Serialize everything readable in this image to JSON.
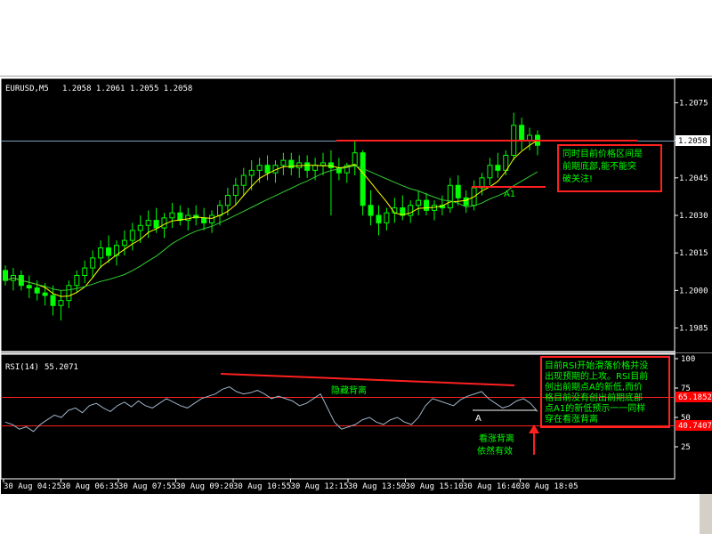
{
  "header": {
    "symbol": "EURUSD,M5",
    "ohlc": "1.2058 1.2061 1.2055 1.2058"
  },
  "rsi_header": {
    "label": "RSI(14)",
    "value": "55.2071"
  },
  "price_axis": {
    "ticks": [
      "1.2075",
      "1.2060",
      "1.2045",
      "1.2030",
      "1.2015",
      "1.2000",
      "1.1985"
    ],
    "tick_values": [
      1.2075,
      1.206,
      1.2045,
      1.203,
      1.2015,
      1.2,
      1.1985
    ],
    "current_price": "1.2058"
  },
  "rsi_axis": {
    "ticks": [
      "100",
      "75",
      "50",
      "25"
    ],
    "tick_values": [
      100,
      75,
      50,
      25
    ],
    "upper_level": "65.1852",
    "lower_level": "40.7407"
  },
  "time_axis": [
    "30 Aug 04:25",
    "30 Aug 06:35",
    "30 Aug 07:55",
    "30 Aug 09:20",
    "30 Aug 10:55",
    "30 Aug 12:15",
    "30 Aug 13:50",
    "30 Aug 15:10",
    "30 Aug 16:40",
    "30 Aug 18:05"
  ],
  "annotations": {
    "price_box": [
      "同时目前价格区间是",
      "前期底部,能不能突",
      "破关注!"
    ],
    "rsi_box": [
      "目前RSI开始滑落价格并没",
      "出现预期的上攻。RSI目前",
      "创出前期点A的新低,而价",
      "格目前没有创出前期底部",
      "点A1的新低预示一一同样",
      "穿在看涨背离"
    ],
    "hidden_divergence": "隐藏背离",
    "bullish_divergence_1": "看涨背离",
    "bullish_divergence_2": "依然有效",
    "point_a": "A",
    "point_a1": "A1"
  },
  "colors": {
    "background": "#000000",
    "bull": "#00ff00",
    "bear": "#00ff00",
    "ma_fast": "#ffff00",
    "ma_slow": "#33cc33",
    "level_line": "#ff0000",
    "rsi_line": "#9fb4c8",
    "annotation_text": "#00ff00"
  },
  "chart_data": [
    {
      "type": "candlestick",
      "title": "EURUSD,M5",
      "ylim": [
        1.198,
        1.208
      ],
      "price_candles_approx": [
        [
          1.2008,
          1.201,
          1.2002,
          1.2004
        ],
        [
          1.2004,
          1.2009,
          1.2,
          1.2006
        ],
        [
          1.2006,
          1.2008,
          1.2,
          1.2002
        ],
        [
          1.2002,
          1.2006,
          1.1997,
          1.2001
        ],
        [
          1.2001,
          1.2004,
          1.1996,
          1.1999
        ],
        [
          1.1999,
          1.2003,
          1.1994,
          1.1998
        ],
        [
          1.1998,
          1.2002,
          1.199,
          1.1994
        ],
        [
          1.1994,
          1.2,
          1.1988,
          1.1996
        ],
        [
          1.1996,
          1.2004,
          1.1993,
          1.2002
        ],
        [
          1.2002,
          1.2008,
          1.1999,
          1.2006
        ],
        [
          1.2006,
          1.2012,
          1.2003,
          1.2009
        ],
        [
          1.2009,
          1.2016,
          1.2005,
          1.2013
        ],
        [
          1.2013,
          1.202,
          1.2009,
          1.2017
        ],
        [
          1.2017,
          1.2022,
          1.2011,
          1.2014
        ],
        [
          1.2014,
          1.202,
          1.201,
          1.2018
        ],
        [
          1.2018,
          1.2024,
          1.2014,
          1.202
        ],
        [
          1.202,
          1.2027,
          1.2016,
          1.2024
        ],
        [
          1.2024,
          1.203,
          1.2019,
          1.2026
        ],
        [
          1.2026,
          1.2032,
          1.2021,
          1.2028
        ],
        [
          1.2028,
          1.2033,
          1.2023,
          1.2025
        ],
        [
          1.2025,
          1.2031,
          1.2021,
          1.2029
        ],
        [
          1.2029,
          1.2035,
          1.2025,
          1.2031
        ],
        [
          1.2031,
          1.2034,
          1.2026,
          1.2028
        ],
        [
          1.2028,
          1.2033,
          1.2024,
          1.203
        ],
        [
          1.203,
          1.2034,
          1.2026,
          1.2029
        ],
        [
          1.2029,
          1.2033,
          1.2024,
          1.2027
        ],
        [
          1.2027,
          1.2032,
          1.2023,
          1.203
        ],
        [
          1.203,
          1.2036,
          1.2026,
          1.2034
        ],
        [
          1.2034,
          1.2041,
          1.203,
          1.2038
        ],
        [
          1.2038,
          1.2045,
          1.2034,
          1.2042
        ],
        [
          1.2042,
          1.2049,
          1.2038,
          1.2046
        ],
        [
          1.2046,
          1.2052,
          1.204,
          1.2048
        ],
        [
          1.2048,
          1.2053,
          1.2043,
          1.205
        ],
        [
          1.205,
          1.2054,
          1.2044,
          1.2047
        ],
        [
          1.2047,
          1.2052,
          1.2043,
          1.205
        ],
        [
          1.205,
          1.2055,
          1.2046,
          1.2052
        ],
        [
          1.2052,
          1.2055,
          1.2046,
          1.2049
        ],
        [
          1.2049,
          1.2054,
          1.2045,
          1.2051
        ],
        [
          1.2051,
          1.2054,
          1.2045,
          1.2048
        ],
        [
          1.2048,
          1.2053,
          1.2044,
          1.205
        ],
        [
          1.205,
          1.2055,
          1.2046,
          1.2051
        ],
        [
          1.2051,
          1.2056,
          1.203,
          1.2049
        ],
        [
          1.2049,
          1.2053,
          1.2044,
          1.2047
        ],
        [
          1.2047,
          1.2051,
          1.2043,
          1.205
        ],
        [
          1.205,
          1.206,
          1.2046,
          1.2055
        ],
        [
          1.2055,
          1.2056,
          1.203,
          1.2034
        ],
        [
          1.2034,
          1.204,
          1.2026,
          1.203
        ],
        [
          1.203,
          1.2034,
          1.2022,
          1.2027
        ],
        [
          1.2027,
          1.2033,
          1.2024,
          1.2031
        ],
        [
          1.2031,
          1.2037,
          1.2027,
          1.2033
        ],
        [
          1.2033,
          1.2038,
          1.2028,
          1.203
        ],
        [
          1.203,
          1.2036,
          1.2027,
          1.2034
        ],
        [
          1.2034,
          1.204,
          1.203,
          1.2036
        ],
        [
          1.2036,
          1.2039,
          1.203,
          1.2032
        ],
        [
          1.2032,
          1.2036,
          1.2028,
          1.2034
        ],
        [
          1.2034,
          1.2038,
          1.203,
          1.2033
        ],
        [
          1.2033,
          1.2045,
          1.2031,
          1.2042
        ],
        [
          1.2042,
          1.2046,
          1.2034,
          1.2037
        ],
        [
          1.2037,
          1.204,
          1.2031,
          1.2034
        ],
        [
          1.2034,
          1.2044,
          1.2032,
          1.2041
        ],
        [
          1.2041,
          1.2047,
          1.2038,
          1.2045
        ],
        [
          1.2045,
          1.2053,
          1.2042,
          1.205
        ],
        [
          1.205,
          1.2055,
          1.2045,
          1.2048
        ],
        [
          1.2048,
          1.2056,
          1.2046,
          1.2054
        ],
        [
          1.2054,
          1.2071,
          1.2052,
          1.2066
        ],
        [
          1.2066,
          1.2069,
          1.2056,
          1.206
        ],
        [
          1.206,
          1.2065,
          1.2056,
          1.2062
        ],
        [
          1.2062,
          1.2064,
          1.2054,
          1.2058
        ]
      ]
    },
    {
      "type": "line",
      "title": "RSI(14)",
      "ylim": [
        0,
        100
      ],
      "series": [
        {
          "name": "RSI(14)",
          "values": [
            46,
            44,
            40,
            42,
            38,
            44,
            48,
            52,
            50,
            56,
            58,
            54,
            60,
            62,
            58,
            55,
            60,
            63,
            59,
            64,
            60,
            58,
            62,
            66,
            63,
            60,
            58,
            62,
            66,
            68,
            70,
            74,
            76,
            72,
            70,
            71,
            73,
            70,
            66,
            68,
            66,
            64,
            60,
            62,
            66,
            70,
            58,
            46,
            40,
            42,
            44,
            48,
            50,
            46,
            44,
            48,
            50,
            46,
            44,
            50,
            60,
            66,
            64,
            62,
            60,
            65,
            68,
            70,
            72,
            66,
            62,
            58,
            60,
            64,
            66,
            62,
            55
          ]
        }
      ],
      "levels": [
        65.1852,
        40.7407
      ]
    }
  ]
}
